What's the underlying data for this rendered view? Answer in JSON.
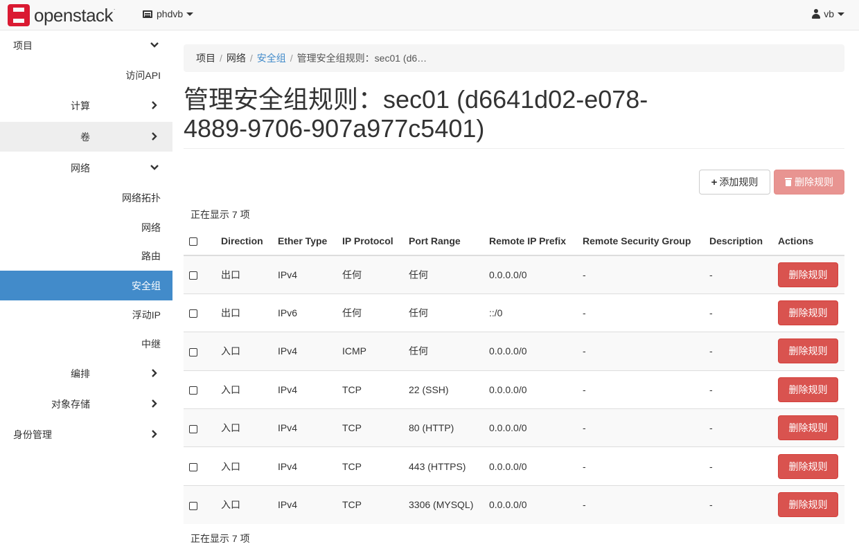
{
  "brand": {
    "name": "openstack",
    "mark": "."
  },
  "header": {
    "project": "phdvb",
    "user": "vb"
  },
  "sidebar": {
    "items": [
      {
        "label": "项目",
        "level": 0,
        "chevron": "down"
      },
      {
        "label": "访问API",
        "level": 2
      },
      {
        "label": "计算",
        "level": 1,
        "chevron": "right"
      },
      {
        "label": "卷",
        "level": 1,
        "chevron": "right"
      },
      {
        "label": "网络",
        "level": 1,
        "chevron": "down"
      },
      {
        "label": "网络拓扑",
        "level": 2
      },
      {
        "label": "网络",
        "level": 2
      },
      {
        "label": "路由",
        "level": 2
      },
      {
        "label": "安全组",
        "level": 2,
        "active": true
      },
      {
        "label": "浮动IP",
        "level": 2
      },
      {
        "label": "中继",
        "level": 2
      },
      {
        "label": "编排",
        "level": 1,
        "chevron": "right"
      },
      {
        "label": "对象存储",
        "level": 1,
        "chevron": "right"
      },
      {
        "label": "身份管理",
        "level": 0,
        "chevron": "right"
      }
    ]
  },
  "breadcrumb": {
    "items": [
      {
        "label": "项目",
        "kind": "plain"
      },
      {
        "label": "网络",
        "kind": "plain"
      },
      {
        "label": "安全组",
        "kind": "link"
      },
      {
        "label": "管理安全组规则：sec01 (d6…",
        "kind": "current"
      }
    ]
  },
  "page": {
    "title_line1": "管理安全组规则：sec01 (d6641d02-e078-",
    "title_line2": "4889-9706-907a977c5401)",
    "add_rule": "添加规则",
    "delete_rules": "删除规则",
    "count_top": "正在显示 7 项",
    "count_bottom": "正在显示 7 项"
  },
  "table": {
    "columns": [
      "Direction",
      "Ether Type",
      "IP Protocol",
      "Port Range",
      "Remote IP Prefix",
      "Remote Security Group",
      "Description",
      "Actions"
    ],
    "rows": [
      {
        "direction": "出口",
        "ether": "IPv4",
        "protocol": "任何",
        "port": "任何",
        "prefix": "0.0.0.0/0",
        "group": "-",
        "desc": "-",
        "action": "删除规则"
      },
      {
        "direction": "出口",
        "ether": "IPv6",
        "protocol": "任何",
        "port": "任何",
        "prefix": "::/0",
        "group": "-",
        "desc": "-",
        "action": "删除规则"
      },
      {
        "direction": "入口",
        "ether": "IPv4",
        "protocol": "ICMP",
        "port": "任何",
        "prefix": "0.0.0.0/0",
        "group": "-",
        "desc": "-",
        "action": "删除规则"
      },
      {
        "direction": "入口",
        "ether": "IPv4",
        "protocol": "TCP",
        "port": "22 (SSH)",
        "prefix": "0.0.0.0/0",
        "group": "-",
        "desc": "-",
        "action": "删除规则"
      },
      {
        "direction": "入口",
        "ether": "IPv4",
        "protocol": "TCP",
        "port": "80 (HTTP)",
        "prefix": "0.0.0.0/0",
        "group": "-",
        "desc": "-",
        "action": "删除规则"
      },
      {
        "direction": "入口",
        "ether": "IPv4",
        "protocol": "TCP",
        "port": "443 (HTTPS)",
        "prefix": "0.0.0.0/0",
        "group": "-",
        "desc": "-",
        "action": "删除规则"
      },
      {
        "direction": "入口",
        "ether": "IPv4",
        "protocol": "TCP",
        "port": "3306 (MYSQL)",
        "prefix": "0.0.0.0/0",
        "group": "-",
        "desc": "-",
        "action": "删除规则"
      }
    ]
  },
  "colors": {
    "primary": "#428bca",
    "danger": "#d9534f",
    "brand": "#da1a32"
  }
}
